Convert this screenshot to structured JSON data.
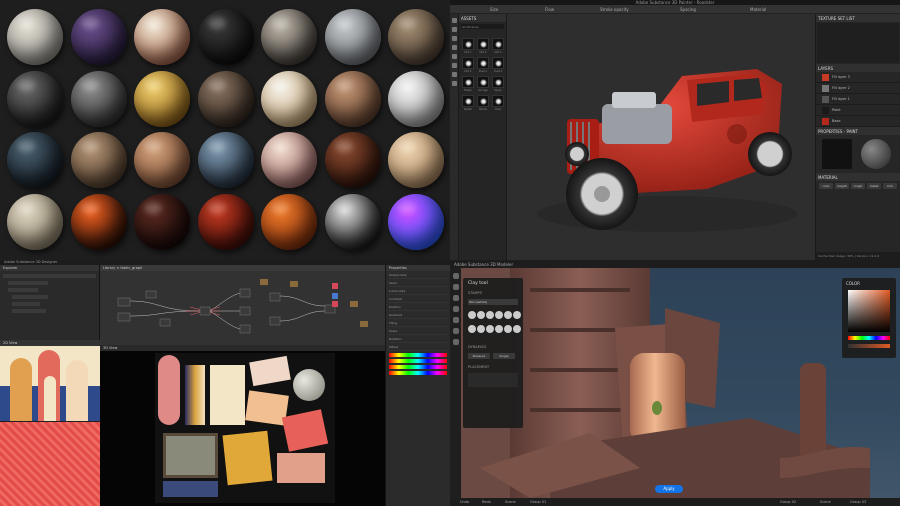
{
  "materials": {
    "spheres": [
      {
        "name": "rough-concrete",
        "colors": [
          "#e3dfd4",
          "#8c8a84"
        ]
      },
      {
        "name": "purple-tiles",
        "colors": [
          "#6a4f8c",
          "#241a3a"
        ]
      },
      {
        "name": "peeling-paint",
        "colors": [
          "#f0e8d6",
          "#a25b3e"
        ]
      },
      {
        "name": "dark-chevron",
        "colors": [
          "#3a3a3a",
          "#0a0a0a"
        ]
      },
      {
        "name": "bark",
        "colors": [
          "#bdb6aa",
          "#3b3530"
        ]
      },
      {
        "name": "light-stone",
        "colors": [
          "#c4c8cb",
          "#6a6e73"
        ]
      },
      {
        "name": "rock-mix",
        "colors": [
          "#a48d72",
          "#4a3c30"
        ]
      },
      {
        "name": "black-rock",
        "colors": [
          "#6a6a6a",
          "#151515"
        ]
      },
      {
        "name": "grey-moon",
        "colors": [
          "#8e8e8e",
          "#2b2b2b"
        ]
      },
      {
        "name": "gold-foil",
        "colors": [
          "#f0cf6e",
          "#8a5b10"
        ]
      },
      {
        "name": "gravel",
        "colors": [
          "#8a7360",
          "#2e241c"
        ]
      },
      {
        "name": "white-cubes",
        "colors": [
          "#f4f1ea",
          "#c8a470"
        ]
      },
      {
        "name": "copper-scales",
        "colors": [
          "#c49675",
          "#5a3a28"
        ]
      },
      {
        "name": "quilted-white",
        "colors": [
          "#f2f2f2",
          "#9a9a9a"
        ]
      },
      {
        "name": "sci-fi-panel",
        "colors": [
          "#4a6070",
          "#101820"
        ]
      },
      {
        "name": "wood-planks",
        "colors": [
          "#b39476",
          "#4e3a28"
        ]
      },
      {
        "name": "striped-wood",
        "colors": [
          "#d2a27c",
          "#7a4a30"
        ]
      },
      {
        "name": "camo",
        "colors": [
          "#7f9ab0",
          "#1c2838"
        ]
      },
      {
        "name": "marble-red",
        "colors": [
          "#f0dccd",
          "#9a6060"
        ]
      },
      {
        "name": "velvet-cloth",
        "colors": [
          "#8a4a30",
          "#2a1008"
        ]
      },
      {
        "name": "plywood",
        "colors": [
          "#eed4b0",
          "#a8825a"
        ]
      },
      {
        "name": "sandstone",
        "colors": [
          "#ded6c2",
          "#8a7e66"
        ]
      },
      {
        "name": "lava",
        "colors": [
          "#f06020",
          "#1a0804"
        ]
      },
      {
        "name": "ember-rock",
        "colors": [
          "#5a2a20",
          "#120606"
        ]
      },
      {
        "name": "red-lacquer",
        "colors": [
          "#c43a22",
          "#3a0a06"
        ]
      },
      {
        "name": "orange-rust",
        "colors": [
          "#f07a2a",
          "#7a2a0a"
        ]
      },
      {
        "name": "black-stripes",
        "colors": [
          "#d8d8d8",
          "#0a0a0a"
        ]
      },
      {
        "name": "iridescent",
        "colors": [
          "#d04cff",
          "#1a60ff"
        ]
      }
    ]
  },
  "painter": {
    "title": "Adobe Substance 3D Painter - Roadster",
    "toolbar": [
      "Size",
      "Flow",
      "Stroke opacity",
      "Spacing",
      "Material"
    ],
    "assets_title": "ASSETS",
    "assets_search": "All libraries",
    "brush_labels": [
      "Dirt 1",
      "Dirt 2",
      "Dirt 3",
      "Dirt 4",
      "Dust 1",
      "Dust 2",
      "Fibers",
      "Grunge",
      "Spray",
      "Splash",
      "Stroke",
      "Rust"
    ],
    "panel_title": "TEXTURE SET LIST",
    "layers_title": "LAYERS",
    "texture_settings": "TEXTURE SET SETTINGS",
    "layers": [
      "Fill layer 3",
      "Fill layer 2",
      "Fill layer 1",
      "Paint",
      "Base"
    ],
    "properties_title": "PROPERTIES - PAINT",
    "material_title": "MATERIAL",
    "channels": [
      "color",
      "height",
      "rough",
      "metal",
      "nrm"
    ],
    "status": "Cache Disk Usage: 36% | Version: 11.0.0"
  },
  "designer": {
    "title": "Adobe Substance 3D Designer",
    "explorer_title": "Explorer",
    "graph_title": "Library  ×  fabric_graph",
    "view3d_title": "3D View",
    "view2d_title": "2D View",
    "properties_title": "Properties",
    "prop_rows": [
      "Output Size",
      "Seed",
      "Luminosity",
      "Contrast",
      "Position",
      "Gradient",
      "Tiling",
      "Scale",
      "Rotation",
      "Offset"
    ]
  },
  "modeler": {
    "title": "Adobe Substance 3D Modeler",
    "menu": [
      "File",
      "Edit",
      "View",
      "Sculpt",
      "Help"
    ],
    "tool_title": "Clay tool",
    "stamps": "STAMPS",
    "stamp_name": "Worn(white)",
    "dynamics": "DYNAMICS",
    "dynamics_opts": [
      "Pressure",
      "Single"
    ],
    "placement": "PLACEMENT",
    "color_title": "COLOR",
    "bottom": [
      "Undo",
      "Redo",
      "Scene",
      "Group 01",
      "Group 02",
      "Scene",
      "Group 03"
    ],
    "apply_label": "Apply"
  }
}
